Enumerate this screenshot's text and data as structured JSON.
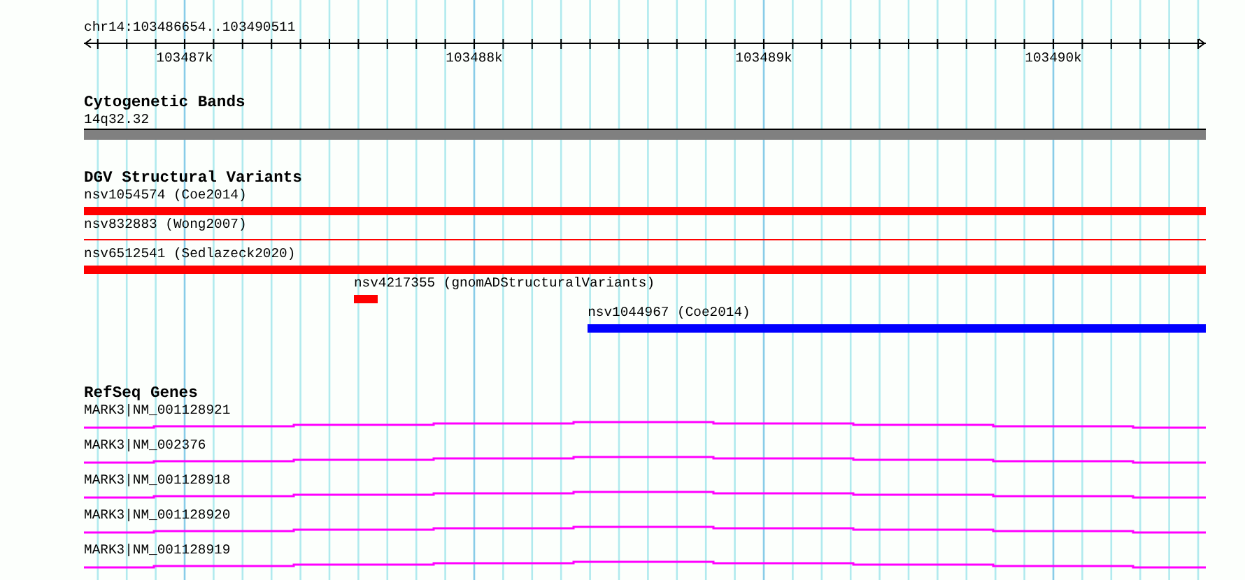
{
  "locus": "chr14:103486654..103490511",
  "ruler": {
    "ticks": [
      "103487k",
      "103488k",
      "103489k",
      "103490k"
    ]
  },
  "tracks": [
    {
      "kind": "bands",
      "title": "Cytogenetic Bands",
      "features": [
        {
          "label": "14q32.32"
        }
      ]
    },
    {
      "kind": "variants",
      "title": "DGV Structural Variants",
      "features": [
        {
          "label": "nsv1054574 (Coe2014)",
          "kind": "bar",
          "color": "#ff0000"
        },
        {
          "label": "nsv832883 (Wong2007)",
          "kind": "line",
          "color": "#ff0000"
        },
        {
          "label": "nsv6512541 (Sedlazeck2020)",
          "kind": "bar",
          "color": "#ff0000"
        },
        {
          "label": "nsv4217355 (gnomADStructuralVariants)",
          "kind": "bar",
          "color": "#ff0000"
        },
        {
          "label": "nsv1044967 (Coe2014)",
          "kind": "bar",
          "color": "#0000ff"
        }
      ]
    },
    {
      "kind": "genes",
      "title": "RefSeq Genes",
      "features": [
        {
          "label": "MARK3|NM_001128921"
        },
        {
          "label": "MARK3|NM_002376"
        },
        {
          "label": "MARK3|NM_001128918"
        },
        {
          "label": "MARK3|NM_001128920"
        },
        {
          "label": "MARK3|NM_001128919"
        }
      ]
    }
  ]
}
